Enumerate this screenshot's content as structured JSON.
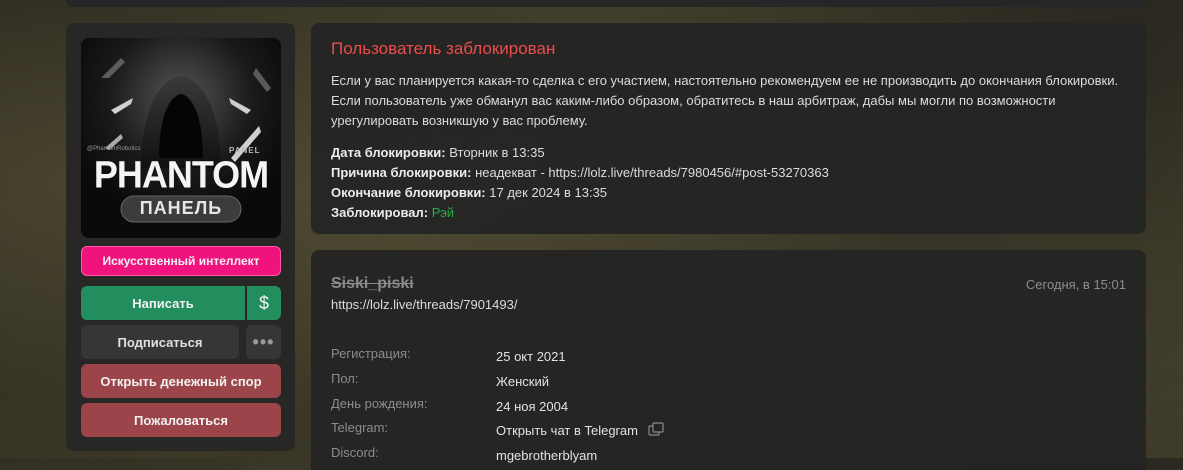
{
  "sidebar": {
    "avatar": {
      "small_text": "@PhantomRobotics",
      "panel_label": "PANEL",
      "brand": "PHANTOM",
      "subtitle": "ПАНЕЛЬ"
    },
    "ai_button": "Искусственный интеллект",
    "write_button": "Написать",
    "dollar_button": "$",
    "subscribe_button": "Подписаться",
    "more_button": "•••",
    "dispute_button": "Открыть денежный спор",
    "report_button": "Пожаловаться"
  },
  "ban": {
    "title": "Пользователь заблокирован",
    "text": "Если у вас планируется какая-то сделка с его участием, настоятельно рекомендуем ее не производить до окончания блокировки. Если пользователь уже обманул вас каким-либо образом, обратитесь в наш арбитраж, дабы мы могли по возможности урегулировать возникшую у вас проблему.",
    "date_label": "Дата блокировки:",
    "date_value": "Вторник в 13:35",
    "reason_label": "Причина блокировки:",
    "reason_value": "неадекват - https://lolz.live/threads/7980456/#post-53270363",
    "end_label": "Окончание блокировки:",
    "end_value": "17 дек 2024 в 13:35",
    "by_label": "Заблокировал:",
    "by_value": "Рэй"
  },
  "profile": {
    "username": "Siski_piski",
    "time": "Сегодня, в 15:01",
    "link": "https://lolz.live/threads/7901493/",
    "info": [
      {
        "label": "Регистрация:",
        "value": "25 окт 2021"
      },
      {
        "label": "Пол:",
        "value": "Женский"
      },
      {
        "label": "День рождения:",
        "value": "24 ноя 2004"
      },
      {
        "label": "Telegram:",
        "value": "Открыть чат в Telegram"
      },
      {
        "label": "Discord:",
        "value": "mgebrotherblyam"
      }
    ]
  },
  "colors": {
    "ai_button": "#f0127d",
    "write_button": "#228e5d",
    "dispute_button": "#9b4449",
    "ban_title": "#ee4b4b",
    "blocked_by": "#2bad45"
  }
}
